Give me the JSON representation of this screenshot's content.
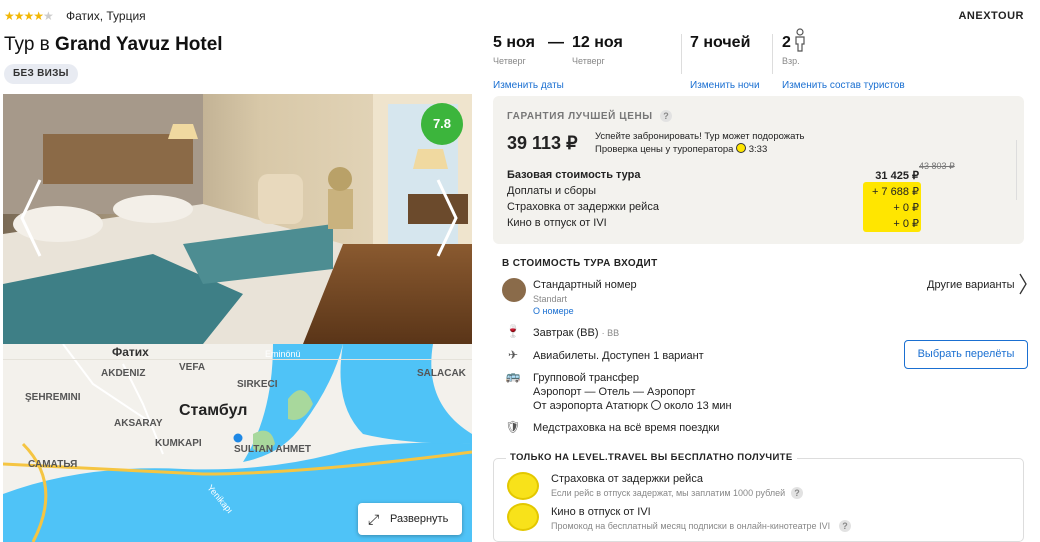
{
  "header": {
    "stars": 4,
    "location": "Фатих, Турция",
    "brand": "ANEXTOUR",
    "title_prefix": "Тур в ",
    "hotel_name": "Grand Yavuz Hotel",
    "visa_badge": "БЕЗ ВИЗЫ"
  },
  "gallery": {
    "rating": "7.8"
  },
  "map": {
    "labels": [
      "Фатих",
      "AKDENIZ",
      "VEFA",
      "SIRKECI",
      "ŞEHREMINI",
      "AKSARAY",
      "KUMKAPI",
      "Стамбул",
      "SULTAN AHMET",
      "САМАТЬЯ",
      "SALACAK",
      "Eminönü",
      "Yenikapı"
    ],
    "expand_label": "Развернуть"
  },
  "trip": {
    "date_from": "5 ноя",
    "day_from": "Четверг",
    "dash": "—",
    "date_to": "12 ноя",
    "day_to": "Четверг",
    "nights": "7 ночей",
    "adults_count": "2",
    "adults_label": "Взр.",
    "change_dates": "Изменить даты",
    "change_nights": "Изменить ночи",
    "change_tourists": "Изменить состав туристов"
  },
  "price": {
    "guarantee_title": "ГАРАНТИЯ ЛУЧШЕЙ ЦЕНЫ",
    "help": "?",
    "total": "39 113 ₽",
    "hurry_line1": "Успейте забронировать! Тур может подорожать",
    "hurry_line2": "Проверка цены у туроператора",
    "timer": "3:33",
    "old_price": "43 803 ₽",
    "rows": [
      {
        "label": "Базовая стоимость тура",
        "value": "31 425 ₽"
      },
      {
        "label": "Доплаты и сборы",
        "value": "+ 7 688 ₽"
      },
      {
        "label": "Страховка от задержки рейса",
        "value": "+ 0 ₽"
      },
      {
        "label": "Кино в отпуск от IVI",
        "value": "+ 0 ₽"
      }
    ]
  },
  "includes": {
    "title": "В СТОИМОСТЬ ТУРА ВХОДИТ",
    "room_name": "Стандартный номер",
    "room_sub": "Standart",
    "room_link": "О номере",
    "other_variants": "Другие варианты",
    "meal": "Завтрак (BB)",
    "meal_code": "· BB",
    "flights": "Авиабилеты. Доступен 1 вариант",
    "choose_flights": "Выбрать перелёты",
    "transfer": "Групповой трансфер",
    "transfer_route": "Аэропорт — Отель — Аэропорт",
    "transfer_from": "От аэропорта Ататюрк",
    "transfer_time": "около 13 мин",
    "insurance": "Медстраховка на всё время поездки"
  },
  "free": {
    "title": "ТОЛЬКО НА LEVEL.TRAVEL ВЫ БЕСПЛАТНО ПОЛУЧИТЕ",
    "items": [
      {
        "title": "Страховка от задержки рейса",
        "desc": "Если рейс в отпуск задержат, мы заплатим 1000 рублей"
      },
      {
        "title": "Кино в отпуск от IVI",
        "desc": "Промокод на бесплатный месяц подписки в онлайн-кинотеатре IVI"
      }
    ]
  },
  "colors": {
    "accent": "#1a6fd1",
    "rating": "#3cb53c",
    "highlight": "#ffe600",
    "star": "#f2b705"
  }
}
